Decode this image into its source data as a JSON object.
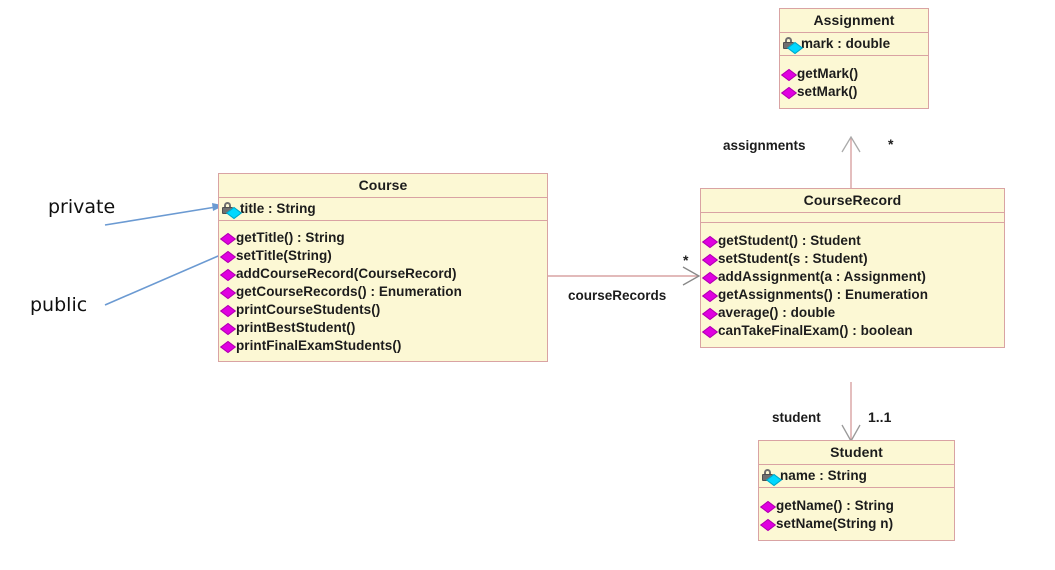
{
  "diagram": {
    "title": "UML Class Diagram",
    "type": "uml-class-diagram",
    "colors": {
      "class_fill": "#fcf8d4",
      "class_border": "#d9a3a3",
      "public_icon": "#e000e0",
      "private_icon": "#00d8ff",
      "lock_icon": "#707070",
      "annotation_arrow": "#6699cc",
      "connector": "#d9a3a3",
      "text": "#1c1c1c",
      "background": "#ffffff"
    }
  },
  "classes": {
    "assignment": {
      "name": "Assignment",
      "attributes": [
        {
          "visibility": "private",
          "icon": "lock-icon",
          "text": "mark : double"
        }
      ],
      "methods": [
        {
          "visibility": "public",
          "icon": "diamond-icon",
          "text": "getMark()"
        },
        {
          "visibility": "public",
          "icon": "diamond-icon",
          "text": "setMark()"
        }
      ]
    },
    "course": {
      "name": "Course",
      "attributes": [
        {
          "visibility": "private",
          "icon": "lock-icon",
          "text": "title : String"
        }
      ],
      "methods": [
        {
          "visibility": "public",
          "icon": "diamond-icon",
          "text": "getTitle() : String"
        },
        {
          "visibility": "public",
          "icon": "diamond-icon",
          "text": "setTitle(String)"
        },
        {
          "visibility": "public",
          "icon": "diamond-icon",
          "text": "addCourseRecord(CourseRecord)"
        },
        {
          "visibility": "public",
          "icon": "diamond-icon",
          "text": "getCourseRecords() : Enumeration"
        },
        {
          "visibility": "public",
          "icon": "diamond-icon",
          "text": "printCourseStudents()"
        },
        {
          "visibility": "public",
          "icon": "diamond-icon",
          "text": "printBestStudent()"
        },
        {
          "visibility": "public",
          "icon": "diamond-icon",
          "text": "printFinalExamStudents()"
        }
      ]
    },
    "course_record": {
      "name": "CourseRecord",
      "attributes": [],
      "methods": [
        {
          "visibility": "public",
          "icon": "diamond-icon",
          "text": "getStudent() : Student"
        },
        {
          "visibility": "public",
          "icon": "diamond-icon",
          "text": "setStudent(s : Student)"
        },
        {
          "visibility": "public",
          "icon": "diamond-icon",
          "text": "addAssignment(a : Assignment)"
        },
        {
          "visibility": "public",
          "icon": "diamond-icon",
          "text": "getAssignments() : Enumeration"
        },
        {
          "visibility": "public",
          "icon": "diamond-icon",
          "text": "average() : double"
        },
        {
          "visibility": "public",
          "icon": "diamond-icon",
          "text": "canTakeFinalExam() : boolean"
        }
      ]
    },
    "student": {
      "name": "Student",
      "attributes": [
        {
          "visibility": "private",
          "icon": "lock-icon",
          "text": "name : String"
        }
      ],
      "methods": [
        {
          "visibility": "public",
          "icon": "diamond-icon",
          "text": "getName() : String"
        },
        {
          "visibility": "public",
          "icon": "diamond-icon",
          "text": "setName(String n)"
        }
      ]
    }
  },
  "associations": [
    {
      "id": "course-to-courserecord",
      "role": "courseRecords",
      "multiplicity": "*",
      "from": "Course",
      "to": "CourseRecord"
    },
    {
      "id": "courserecord-to-assignment",
      "role": "assignments",
      "multiplicity": "*",
      "from": "CourseRecord",
      "to": "Assignment"
    },
    {
      "id": "courserecord-to-student",
      "role": "student",
      "multiplicity": "1..1",
      "from": "CourseRecord",
      "to": "Student"
    }
  ],
  "annotations": [
    {
      "id": "private-note",
      "text": "private",
      "points_to": "title attribute of Course"
    },
    {
      "id": "public-note",
      "text": "public",
      "points_to": "methods of Course"
    }
  ]
}
